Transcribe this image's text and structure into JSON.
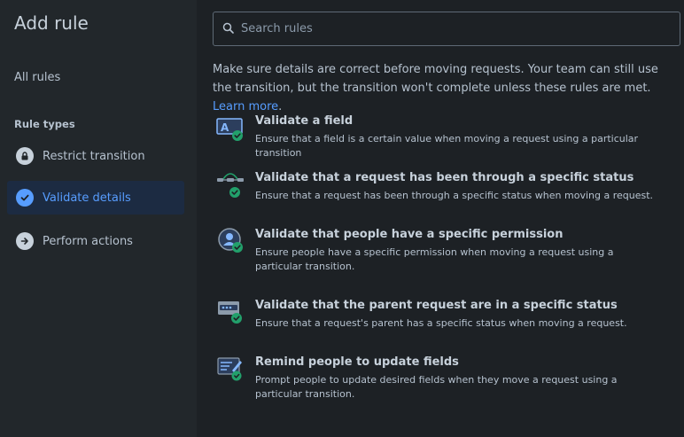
{
  "sidebar": {
    "title": "Add rule",
    "all_rules": "All rules",
    "section_label": "Rule types",
    "items": [
      {
        "label": "Restrict transition",
        "icon": "lock-icon"
      },
      {
        "label": "Validate details",
        "icon": "check-circle-icon",
        "selected": true
      },
      {
        "label": "Perform actions",
        "icon": "arrow-right-circle-icon"
      }
    ]
  },
  "search": {
    "placeholder": "Search rules",
    "value": ""
  },
  "intro": {
    "text": "Make sure details are correct before moving requests. Your team can still use the transition, but the transition won't complete unless these rules are met. ",
    "link": "Learn more",
    "end": "."
  },
  "rules": [
    {
      "title": "Validate a field",
      "description": "Ensure that a field is a certain value when moving a request using a particular transition",
      "icon": "field-validate-icon"
    },
    {
      "title": "Validate that a request has been through a specific status",
      "description": "Ensure that a request has been through a specific status when moving a request.",
      "icon": "status-flow-icon"
    },
    {
      "title": "Validate that people have a specific permission",
      "description": "Ensure people have a specific permission when moving a request using a particular transition.",
      "icon": "person-permission-icon"
    },
    {
      "title": "Validate that the parent request are in a specific status",
      "description": "Ensure that a request's parent has a specific status when moving a request.",
      "icon": "parent-status-icon"
    },
    {
      "title": "Remind people to update fields",
      "description": "Prompt people to update desired fields when they move a request using a particular transition.",
      "icon": "edit-reminder-icon"
    }
  ],
  "colors": {
    "background": "#1d2125",
    "sidebar": "#22272b",
    "accent": "#579dff",
    "selected_bg": "#1c2b42",
    "success": "#22a06b"
  }
}
